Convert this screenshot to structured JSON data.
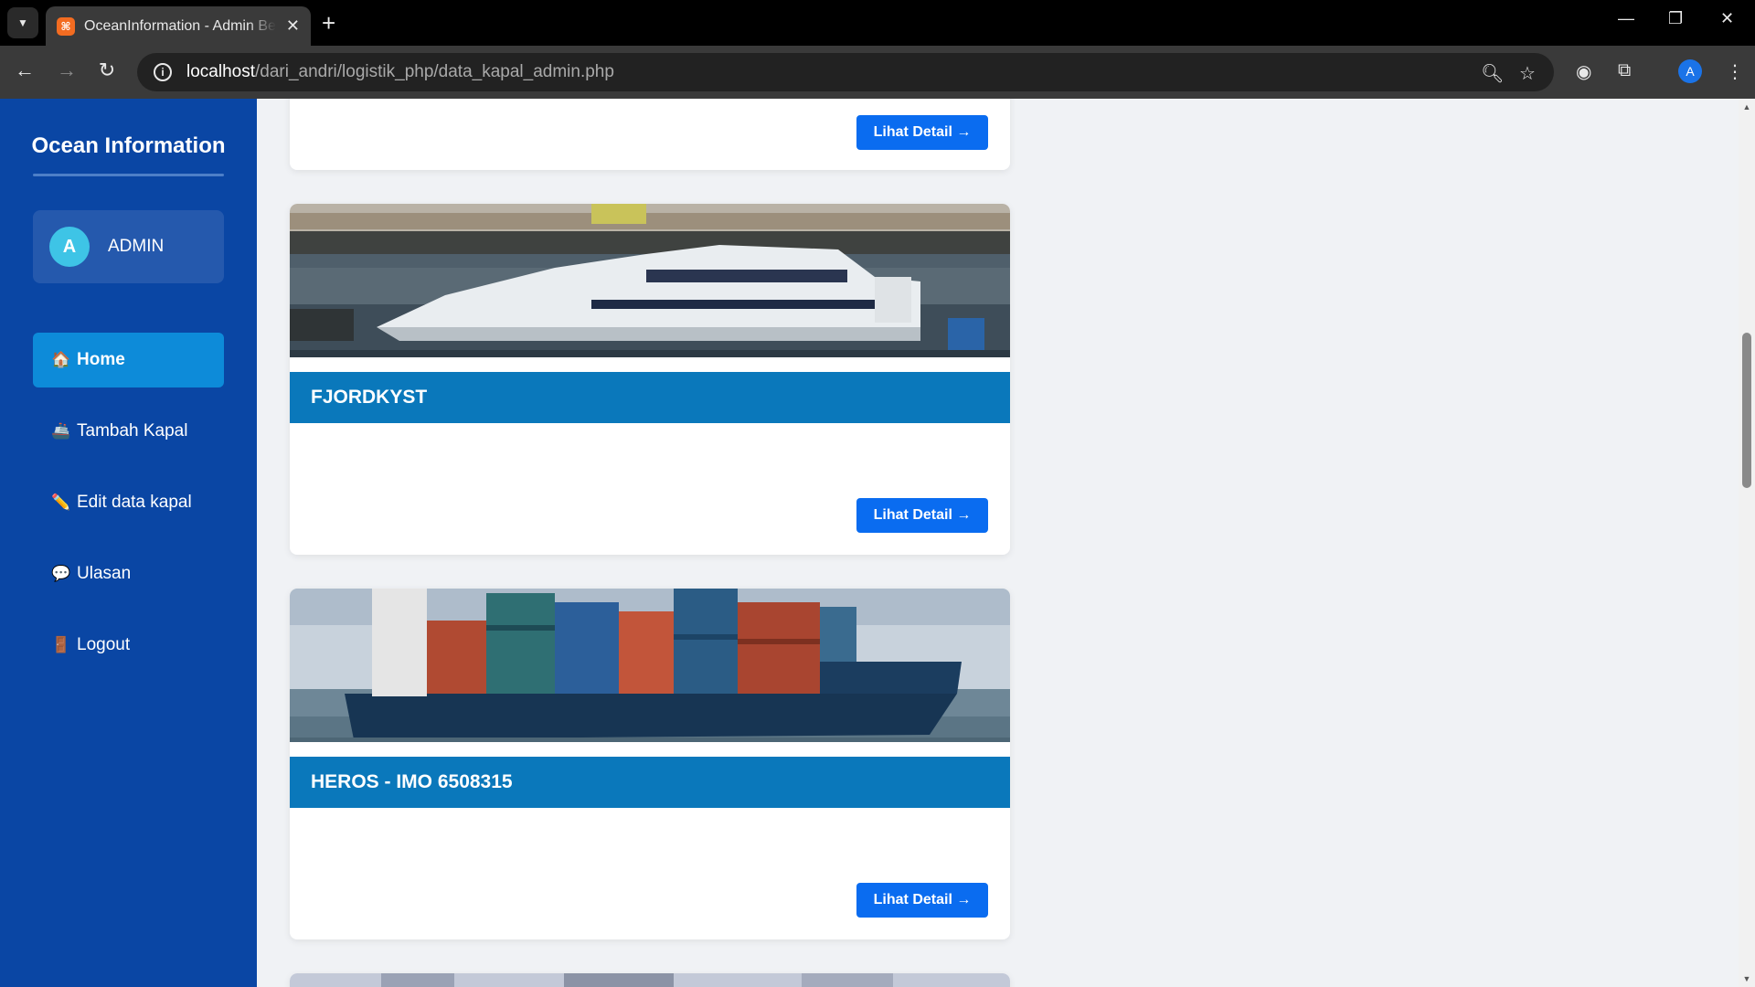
{
  "browser": {
    "tab_title": "OceanInformation - Admin Beranda",
    "favicon_letter": "⌘",
    "url_host": "localhost",
    "url_path": "/dari_andri/logistik_php/data_kapal_admin.php",
    "profile_initial": "A"
  },
  "sidebar": {
    "brand": "Ocean Information",
    "user": {
      "initial": "A",
      "name": "ADMIN"
    },
    "items": [
      {
        "icon": "🏠",
        "label": "Home",
        "active": true
      },
      {
        "icon": "🚢",
        "label": "Tambah Kapal",
        "active": false
      },
      {
        "icon": "✏️",
        "label": "Edit data kapal",
        "active": false
      },
      {
        "icon": "💬",
        "label": "Ulasan",
        "active": false
      },
      {
        "icon": "🚪",
        "label": "Logout",
        "active": false
      }
    ]
  },
  "ships": [
    {
      "name": "",
      "button": "Lihat Detail →"
    },
    {
      "name": "FJORDKYST",
      "button": "Lihat Detail →"
    },
    {
      "name": "HEROS - IMO 6508315",
      "button": "Lihat Detail →"
    }
  ],
  "colors": {
    "sidebar": "#0a46a4",
    "active_menu": "#0d8bd9",
    "card_title": "#0a78bb",
    "button": "#0a6cf0"
  }
}
